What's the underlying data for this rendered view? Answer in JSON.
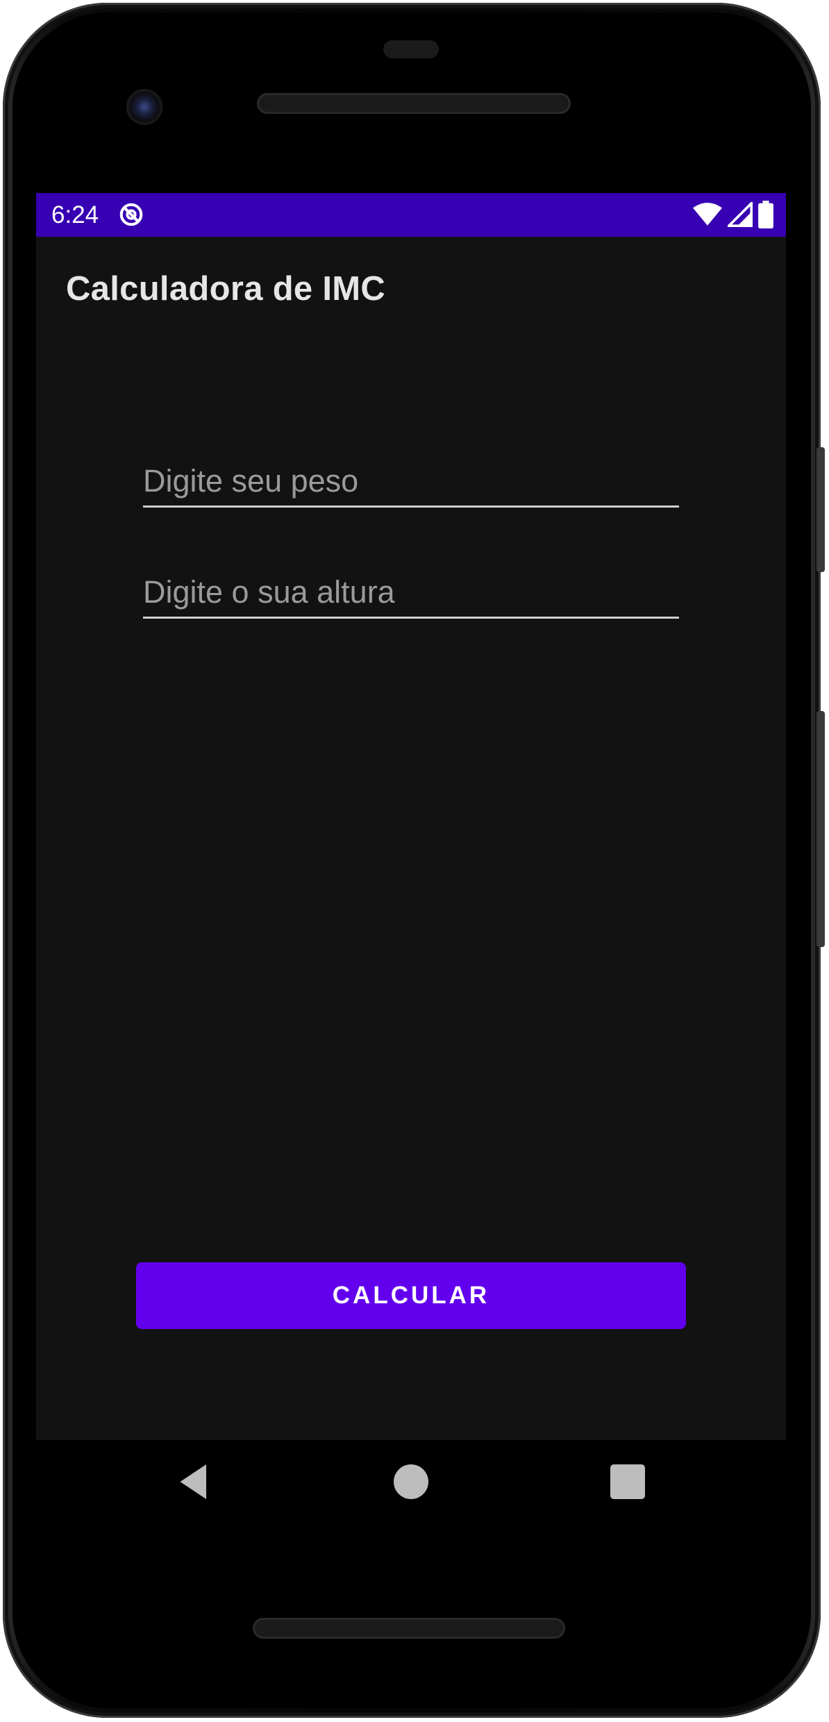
{
  "status_bar": {
    "time": "6:24",
    "icons": [
      "app-notification-icon",
      "wifi-icon",
      "cellular-signal-icon",
      "battery-icon"
    ],
    "background_color": "#3700b3"
  },
  "app_bar": {
    "title": "Calculadora de IMC"
  },
  "form": {
    "weight_field": {
      "placeholder": "Digite seu peso",
      "value": ""
    },
    "height_field": {
      "placeholder": "Digite o sua altura",
      "value": ""
    },
    "calculate_button": {
      "label": "CALCULAR",
      "color": "#6200ee"
    }
  },
  "nav_bar": {
    "icons": [
      "back-icon",
      "home-icon",
      "recents-icon"
    ]
  },
  "theme": {
    "screen_background": "#121212"
  }
}
